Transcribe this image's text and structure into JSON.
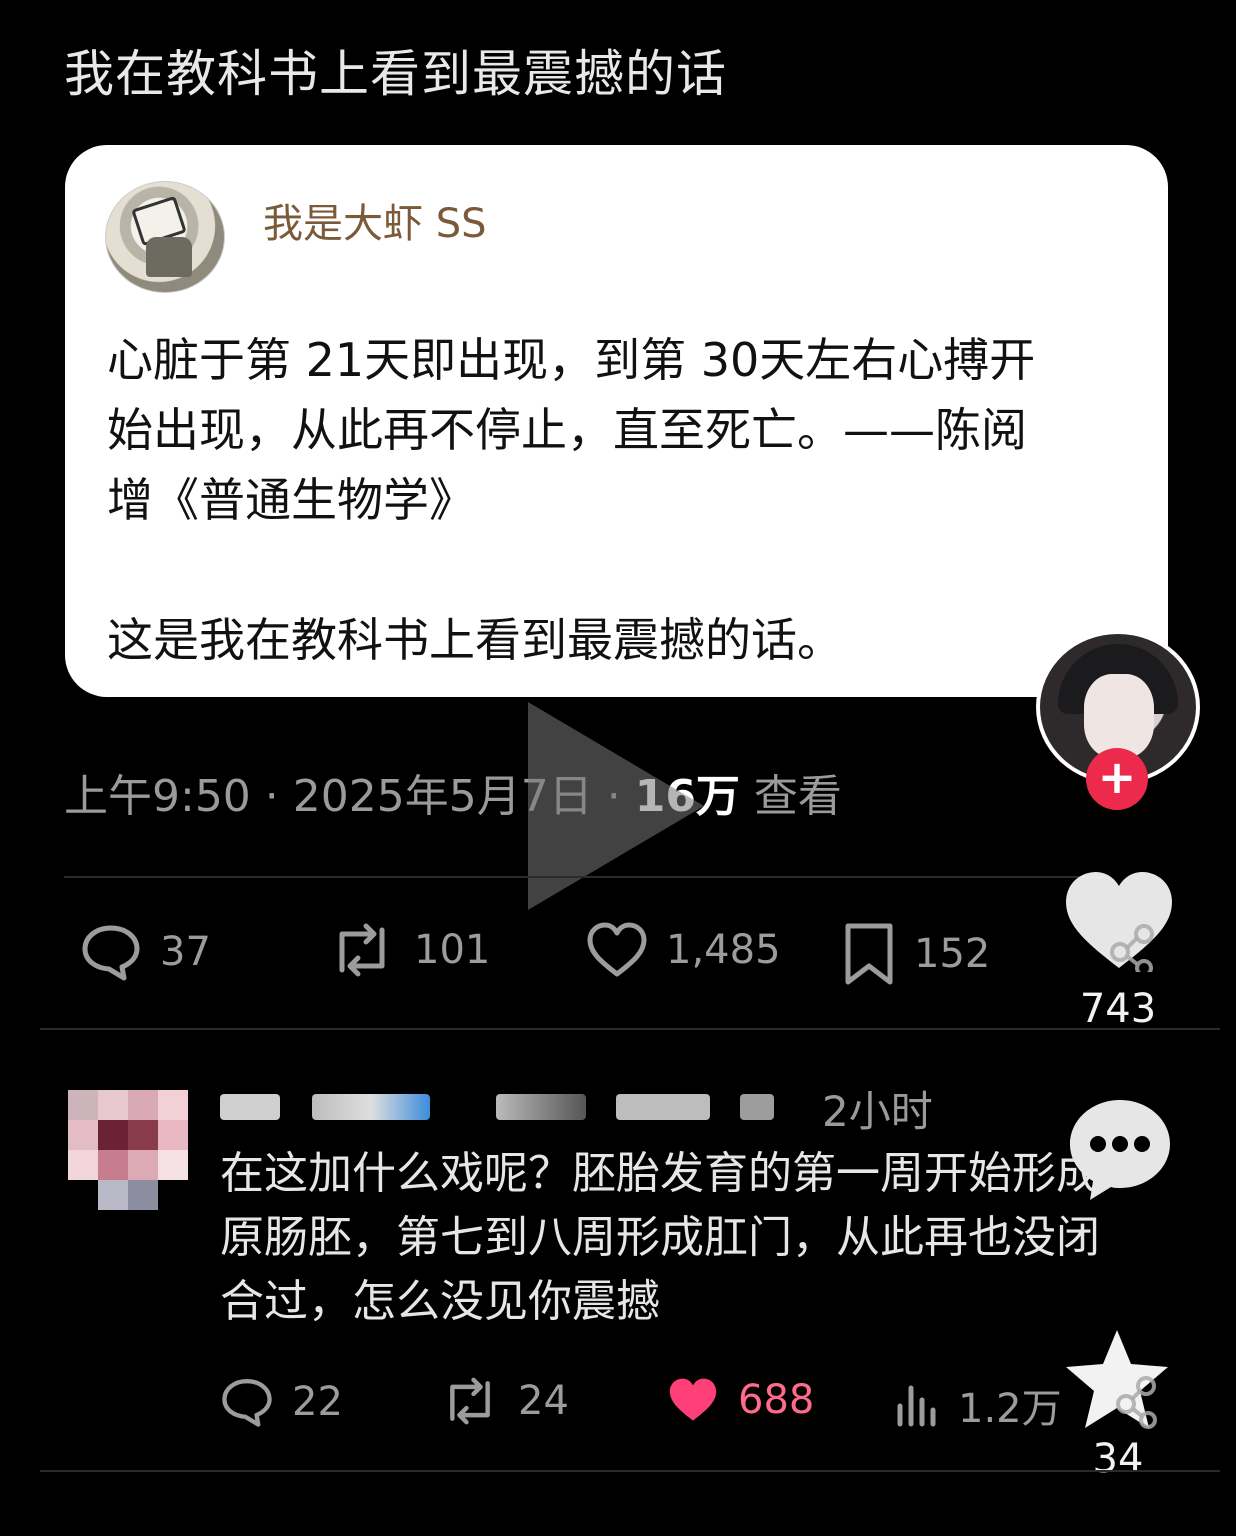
{
  "page": {
    "title": "我在教科书上看到最震撼的话"
  },
  "post": {
    "username": "我是大虾 SS",
    "text_lines": [
      "心脏于第 21天即出现，到第 30天左右心搏开",
      "始出现，从此再不停止，直至死亡。——陈阅",
      "增《普通生物学》"
    ],
    "text_line2": "这是我在教科书上看到最震撼的话。",
    "time": "上午9:50 · 2025年5月7日 · ",
    "views_value": "16万",
    "views_label": " 查看",
    "actions": {
      "replies": "37",
      "reposts": "101",
      "likes": "1,485",
      "bookmarks": "152"
    }
  },
  "side_panel": {
    "like_count": "743",
    "star_count": "34",
    "plus_label": "+"
  },
  "comment": {
    "time": "2小时",
    "text_lines": [
      "在这加什么戏呢？胚胎发育的第一周开始形成",
      "原肠胚，第七到八周形成肛门，从此再也没闭",
      "合过，怎么没见你震撼"
    ],
    "actions": {
      "replies": "22",
      "reposts": "24",
      "likes": "688",
      "views": "1.2万"
    }
  },
  "colors": {
    "background": "#000000",
    "card": "#ffffff",
    "accent_pink": "#ee2a4c",
    "username_brown": "#7a5a38"
  }
}
